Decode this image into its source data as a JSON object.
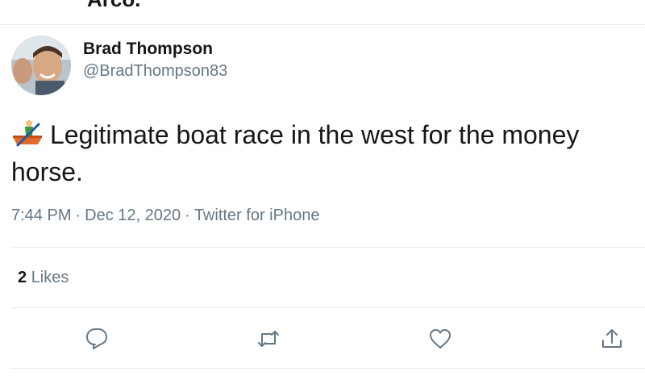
{
  "previous_tweet": {
    "cut_text": "Arco."
  },
  "author": {
    "display_name": "Brad Thompson",
    "handle": "@BradThompson83"
  },
  "tweet": {
    "emoji": "person-rowing-boat-emoji",
    "text": "Legitimate boat race in the west for the money horse."
  },
  "meta": {
    "time": "7:44 PM",
    "separator": "·",
    "date": "Dec 12, 2020",
    "source": "Twitter for iPhone"
  },
  "stats": {
    "likes_count": "2",
    "likes_label": "Likes"
  },
  "actions": {
    "reply_icon": "reply-icon",
    "retweet_icon": "retweet-icon",
    "like_icon": "heart-icon",
    "share_icon": "share-icon"
  },
  "colors": {
    "text": "#14171a",
    "secondary": "#657786",
    "divider": "#e6ecf0"
  }
}
